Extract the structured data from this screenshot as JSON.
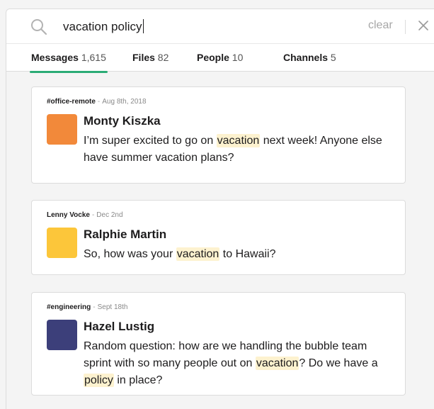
{
  "search": {
    "query": "vacation policy",
    "clear_label": "clear"
  },
  "tabs": [
    {
      "label": "Messages",
      "count": "1,615",
      "active": true
    },
    {
      "label": "Files",
      "count": "82",
      "active": false
    },
    {
      "label": "People",
      "count": "10",
      "active": false
    },
    {
      "label": "Channels",
      "count": "5",
      "active": false
    }
  ],
  "results": [
    {
      "context": "#office-remote",
      "date": "Aug 8th, 2018",
      "author": "Monty Kiszka",
      "avatar_color": "#f2893a",
      "message": [
        {
          "text": "I’m super excited to go on "
        },
        {
          "text": "vacation",
          "highlight": true
        },
        {
          "text": " next week! Anyone else have summer vacation plans?"
        }
      ]
    },
    {
      "context": "Lenny Vocke",
      "date": "Dec 2nd",
      "author": "Ralphie Martin",
      "avatar_color": "#fcc63a",
      "message": [
        {
          "text": "So, how was your "
        },
        {
          "text": "vacation",
          "highlight": true
        },
        {
          "text": " to Hawaii?"
        }
      ]
    },
    {
      "context": "#engineering",
      "date": "Sept 18th",
      "author": "Hazel Lustig",
      "avatar_color": "#3c3f7a",
      "message": [
        {
          "text": "Random question: how are we handling the bubble team sprint with so many people out on "
        },
        {
          "text": "vacation",
          "highlight": true
        },
        {
          "text": "? Do we have a "
        },
        {
          "text": "policy",
          "highlight": true
        },
        {
          "text": " in place?"
        }
      ]
    }
  ],
  "colors": {
    "accent": "#2bac76",
    "highlight": "#fdf2cf"
  }
}
